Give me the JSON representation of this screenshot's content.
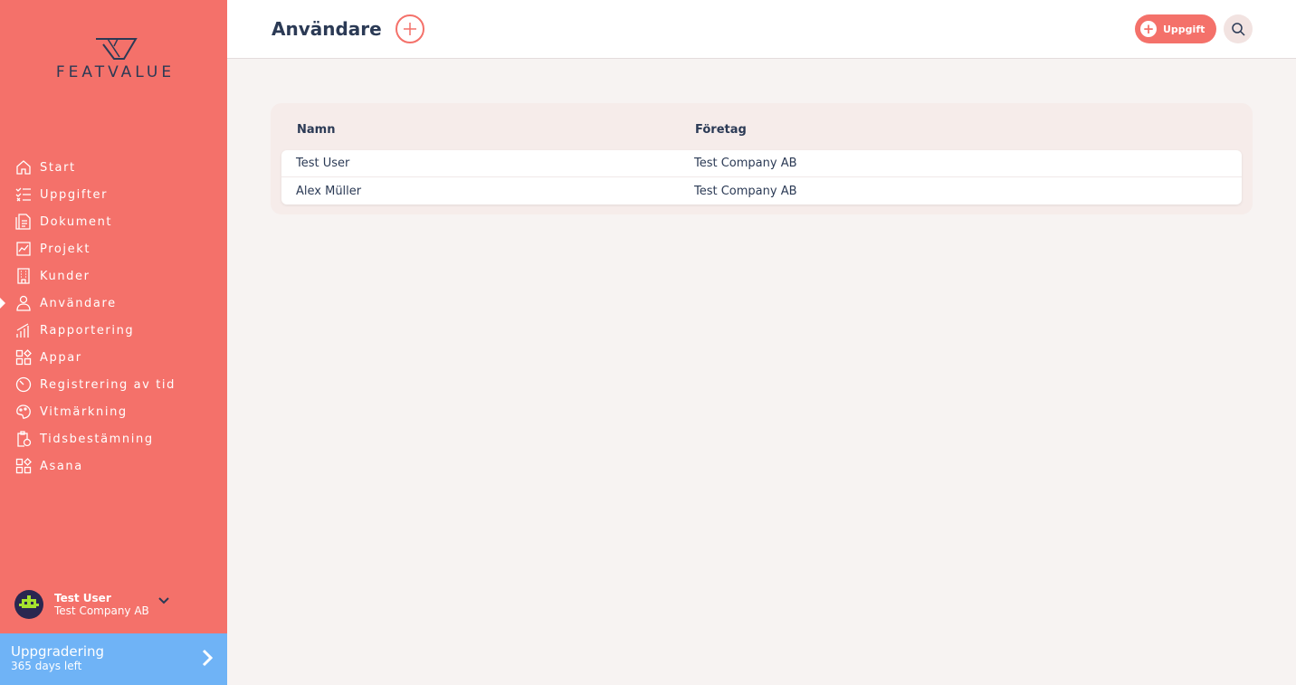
{
  "brand": {
    "name": "FEATVALUE"
  },
  "sidebar": {
    "items": [
      {
        "label": "Start",
        "icon": "home-icon"
      },
      {
        "label": "Uppgifter",
        "icon": "checklist-icon"
      },
      {
        "label": "Dokument",
        "icon": "document-icon"
      },
      {
        "label": "Projekt",
        "icon": "chart-icon"
      },
      {
        "label": "Kunder",
        "icon": "building-icon"
      },
      {
        "label": "Användare",
        "icon": "user-icon",
        "active": true
      },
      {
        "label": "Rapportering",
        "icon": "bars-icon"
      },
      {
        "label": "Appar",
        "icon": "apps-icon"
      },
      {
        "label": "Registrering av tid",
        "icon": "timer-icon"
      },
      {
        "label": "Vitmärkning",
        "icon": "palette-icon"
      },
      {
        "label": "Tidsbestämning",
        "icon": "clipboard-clock-icon"
      },
      {
        "label": "Asana",
        "icon": "apps-icon"
      }
    ],
    "user": {
      "name": "Test User",
      "company": "Test Company AB"
    },
    "upgrade": {
      "title": "Uppgradering",
      "days": "365 days left"
    }
  },
  "header": {
    "title": "Användare",
    "task_label": "Uppgift"
  },
  "table": {
    "headers": [
      "Namn",
      "Företag"
    ],
    "rows": [
      [
        "Test User",
        "Test Company AB"
      ],
      [
        "Alex Müller",
        "Test Company AB"
      ]
    ]
  },
  "colors": {
    "sidebar": "#f4716a",
    "upgrade": "#6fb3f6",
    "text": "#2b3a55"
  }
}
